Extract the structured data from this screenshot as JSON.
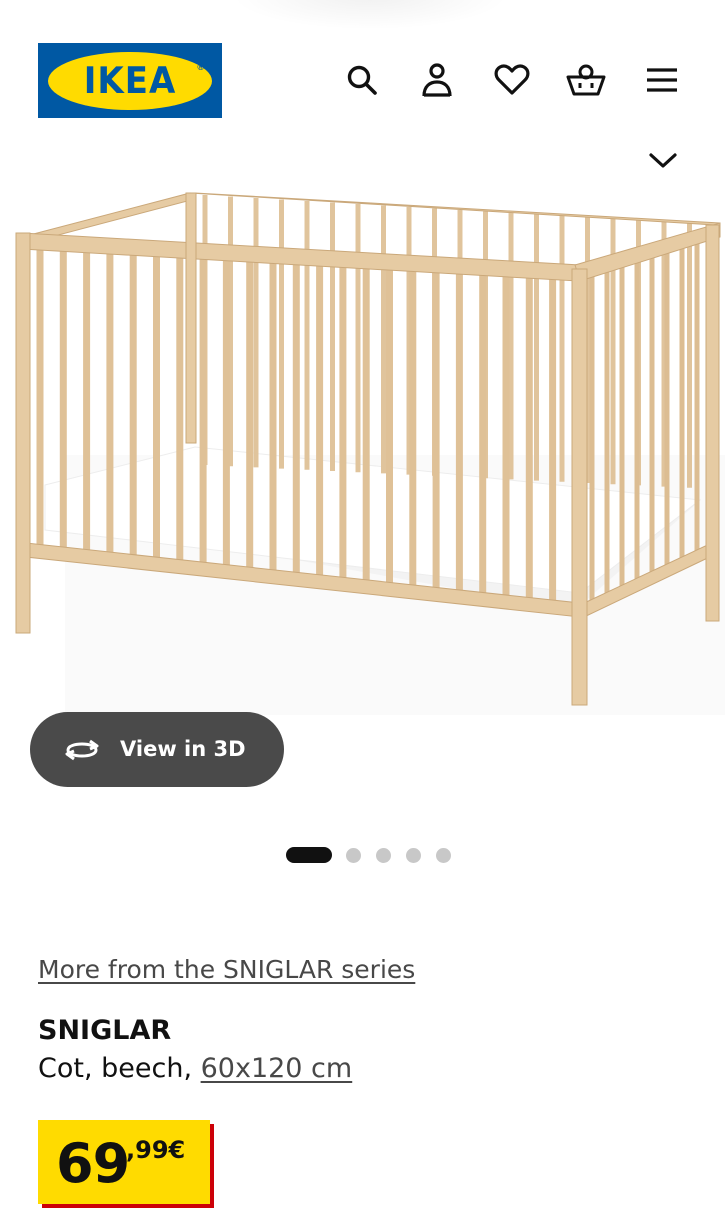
{
  "header": {
    "logo_text": "IKEA",
    "logo_reg": "®",
    "icons": [
      "search-icon",
      "user-icon",
      "heart-icon",
      "basket-icon",
      "menu-icon",
      "chevron-down-icon"
    ]
  },
  "gallery": {
    "view_3d_label": "View in 3D",
    "image_count": 5,
    "active_index": 0
  },
  "product": {
    "series_link": "More from the SNIGLAR series",
    "name": "SNIGLAR",
    "description_prefix": "Cot, beech, ",
    "size": "60x120 cm",
    "price_integer": "69",
    "price_decimal": ",99€"
  },
  "colors": {
    "brand_blue": "#0058a3",
    "brand_yellow": "#ffdb00",
    "price_shadow_red": "#cc0008",
    "button_grey": "#4a4a4a",
    "wood": "#e2c7a0"
  }
}
